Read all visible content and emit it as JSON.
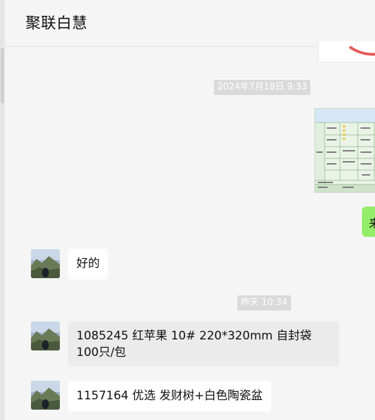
{
  "window": {
    "title": "聚联白慧"
  },
  "messages": [
    {
      "type": "timestamp",
      "text": "2024年7月18日 9:33"
    },
    {
      "type": "image",
      "side": "right",
      "icon": "spreadsheet-image"
    },
    {
      "type": "text",
      "side": "right",
      "text": "来"
    },
    {
      "type": "text",
      "side": "left",
      "text": "好的"
    },
    {
      "type": "timestamp",
      "text": "昨天 10:34"
    },
    {
      "type": "text",
      "side": "left",
      "text": "1085245 红苹果 10# 220*320mm 自封袋 100只/包"
    },
    {
      "type": "text",
      "side": "left",
      "text": "1157164 优选 发财树+白色陶瓷盆"
    }
  ],
  "colors": {
    "self_bubble": "#95ec69",
    "other_bubble": "#ffffff",
    "background": "#f5f5f5",
    "timestamp_bg": "#dadada"
  }
}
